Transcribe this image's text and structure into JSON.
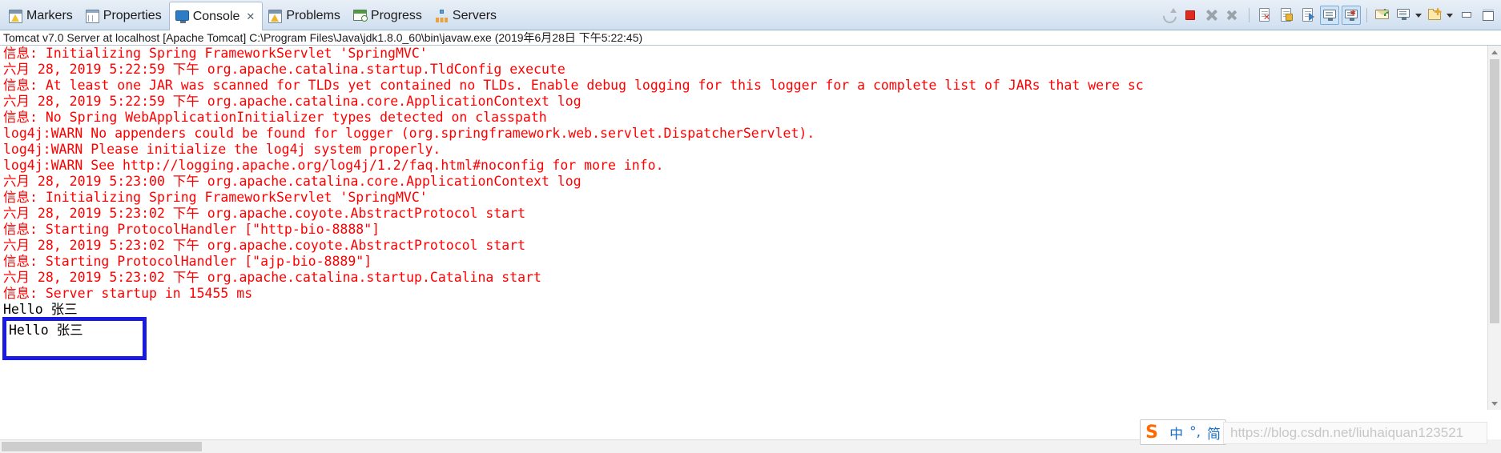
{
  "window": {
    "tabs": [
      {
        "label": "Markers",
        "icon": "markers-icon",
        "active": false,
        "closable": false
      },
      {
        "label": "Properties",
        "icon": "properties-icon",
        "active": false,
        "closable": false
      },
      {
        "label": "Console",
        "icon": "console-icon",
        "active": true,
        "closable": true,
        "close_glyph": "✕"
      },
      {
        "label": "Problems",
        "icon": "problems-icon",
        "active": false,
        "closable": false
      },
      {
        "label": "Progress",
        "icon": "progress-icon",
        "active": false,
        "closable": false
      },
      {
        "label": "Servers",
        "icon": "servers-icon",
        "active": false,
        "closable": false
      }
    ]
  },
  "toolbar": {
    "buttons": [
      {
        "name": "relaunch-button",
        "title": "Relaunch"
      },
      {
        "name": "terminate-button",
        "title": "Terminate"
      },
      {
        "name": "remove-launch-button",
        "title": "Remove Launch"
      },
      {
        "name": "remove-all-terminated-button",
        "title": "Remove All Terminated Launches"
      },
      {
        "name": "clear-console-button",
        "title": "Clear Console"
      },
      {
        "name": "scroll-lock-button",
        "title": "Scroll Lock"
      },
      {
        "name": "word-wrap-button",
        "title": "Word Wrap"
      },
      {
        "name": "show-console-on-output-button",
        "title": "Show Console When Standard Out Changes",
        "selected": true
      },
      {
        "name": "show-console-on-error-button",
        "title": "Show Console When Standard Error Changes",
        "selected": true
      },
      {
        "name": "pin-console-button",
        "title": "Pin Console"
      },
      {
        "name": "display-selected-console-button",
        "title": "Display Selected Console"
      },
      {
        "name": "open-console-button",
        "title": "Open Console"
      },
      {
        "name": "minimize-button",
        "title": "Minimize"
      },
      {
        "name": "maximize-button",
        "title": "Maximize"
      }
    ]
  },
  "process": {
    "description": "Tomcat v7.0 Server at localhost [Apache Tomcat] C:\\Program Files\\Java\\jdk1.8.0_60\\bin\\javaw.exe (2019年6月28日 下午5:22:45)"
  },
  "console": {
    "lines": [
      {
        "text": "信息: Initializing Spring FrameworkServlet 'SpringMVC'",
        "color": "#ff0000"
      },
      {
        "text": "六月 28, 2019 5:22:59 下午 org.apache.catalina.startup.TldConfig execute",
        "color": "#ff0000"
      },
      {
        "text": "信息: At least one JAR was scanned for TLDs yet contained no TLDs. Enable debug logging for this logger for a complete list of JARs that were sc",
        "color": "#ff0000"
      },
      {
        "text": "六月 28, 2019 5:22:59 下午 org.apache.catalina.core.ApplicationContext log",
        "color": "#ff0000"
      },
      {
        "text": "信息: No Spring WebApplicationInitializer types detected on classpath",
        "color": "#ff0000"
      },
      {
        "text": "log4j:WARN No appenders could be found for logger (org.springframework.web.servlet.DispatcherServlet).",
        "color": "#ff0000"
      },
      {
        "text": "log4j:WARN Please initialize the log4j system properly.",
        "color": "#ff0000"
      },
      {
        "text": "log4j:WARN See http://logging.apache.org/log4j/1.2/faq.html#noconfig for more info.",
        "color": "#ff0000"
      },
      {
        "text": "六月 28, 2019 5:23:00 下午 org.apache.catalina.core.ApplicationContext log",
        "color": "#ff0000"
      },
      {
        "text": "信息: Initializing Spring FrameworkServlet 'SpringMVC'",
        "color": "#ff0000"
      },
      {
        "text": "六月 28, 2019 5:23:02 下午 org.apache.coyote.AbstractProtocol start",
        "color": "#ff0000"
      },
      {
        "text": "信息: Starting ProtocolHandler [\"http-bio-8888\"]",
        "color": "#ff0000"
      },
      {
        "text": "六月 28, 2019 5:23:02 下午 org.apache.coyote.AbstractProtocol start",
        "color": "#ff0000"
      },
      {
        "text": "信息: Starting ProtocolHandler [\"ajp-bio-8889\"]",
        "color": "#ff0000"
      },
      {
        "text": "六月 28, 2019 5:23:02 下午 org.apache.catalina.startup.Catalina start",
        "color": "#ff0000"
      },
      {
        "text": "信息: Server startup in 15455 ms",
        "color": "#ff0000"
      },
      {
        "text": "Hello 张三",
        "color": "#000000"
      }
    ]
  },
  "highlight": {
    "text": "Hello 张三",
    "border_color": "#1a1ae0"
  },
  "ime": {
    "logo": "S",
    "items": [
      "中",
      "°,",
      "简"
    ]
  },
  "watermark": {
    "text": "https://blog.csdn.net/liuhaiquan123521"
  }
}
